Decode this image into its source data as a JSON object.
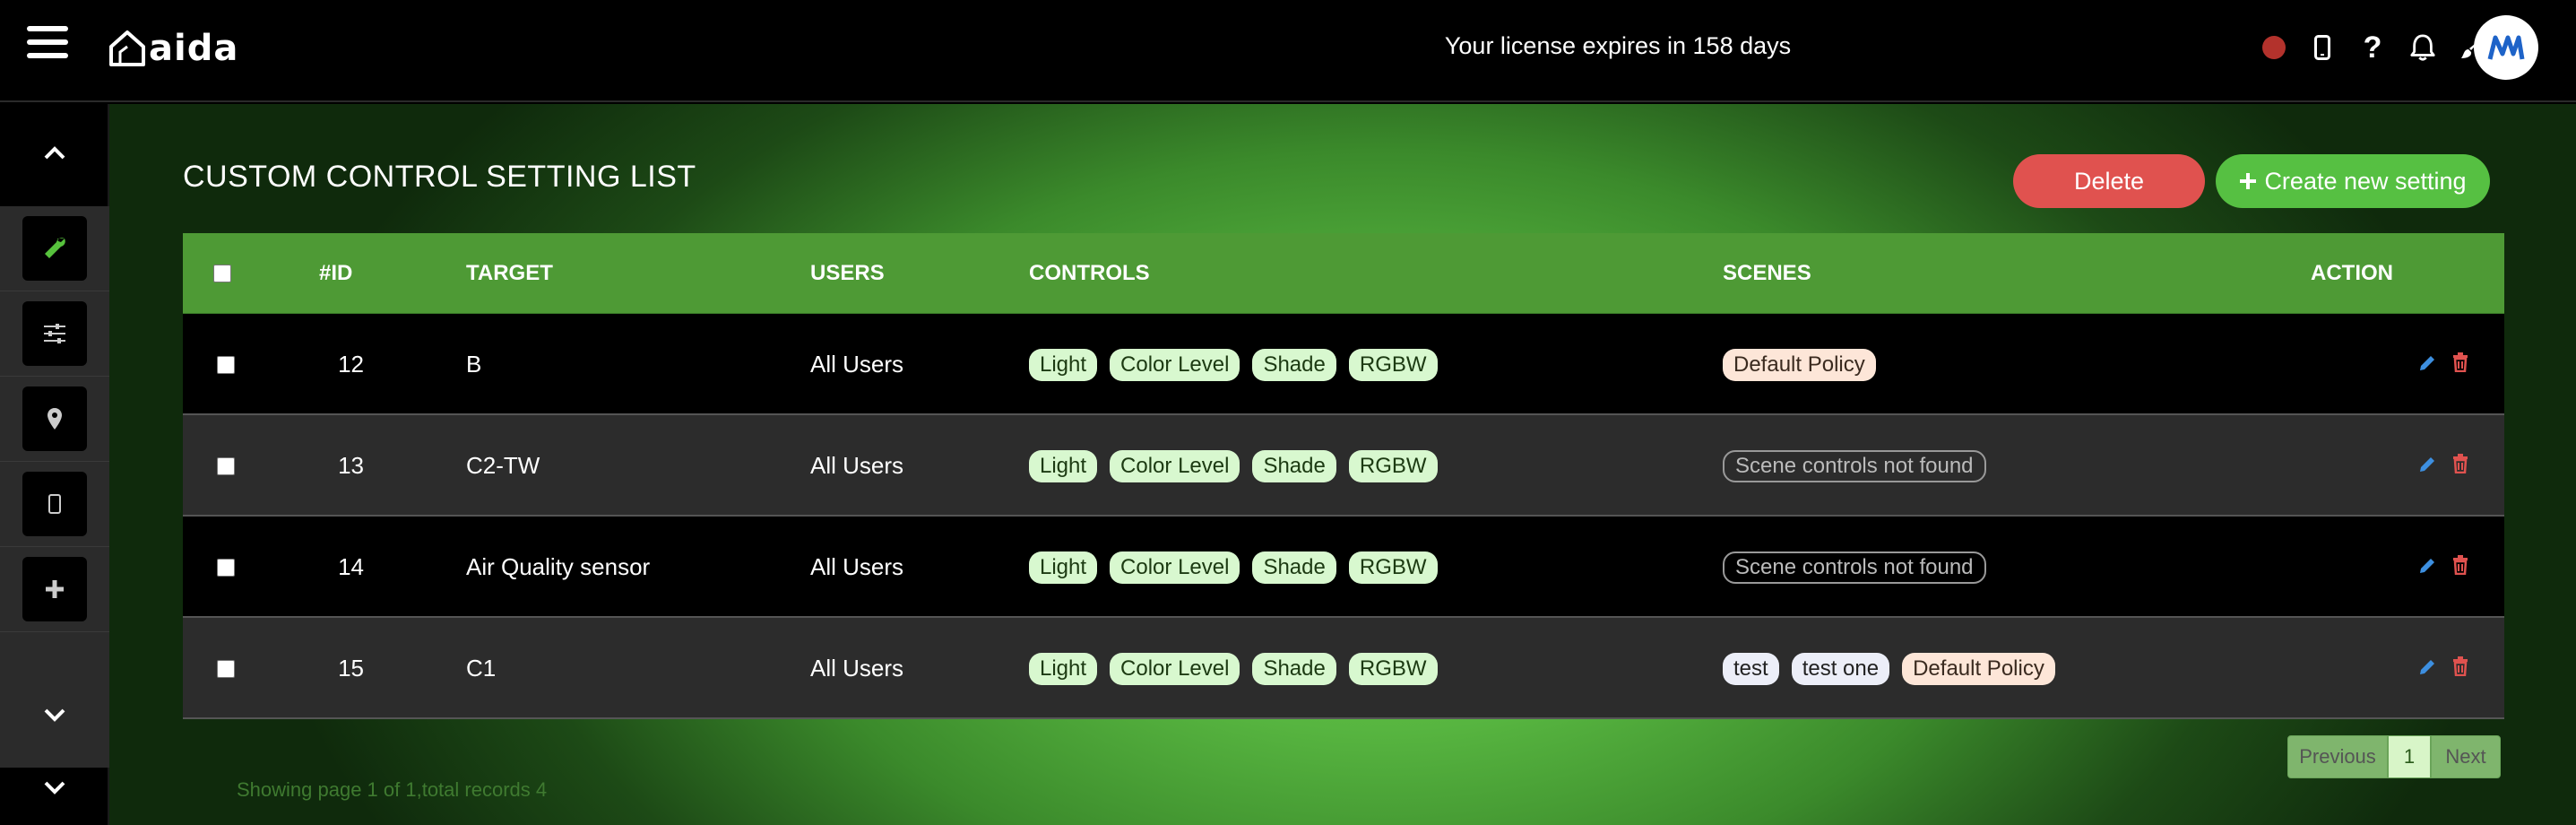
{
  "header": {
    "logo_text": "aida",
    "license_text": "Your license expires in 158 days",
    "icons": [
      "record-dot-icon",
      "mobile-icon",
      "help-icon",
      "bell-icon",
      "brush-icon",
      "user-avatar"
    ]
  },
  "sidebar": {
    "items": [
      {
        "icon": "wrench-icon",
        "active": true
      },
      {
        "icon": "sliders-icon"
      },
      {
        "icon": "location-icon"
      },
      {
        "icon": "mobile-icon"
      },
      {
        "icon": "plus-icon"
      }
    ]
  },
  "page": {
    "title": "CUSTOM CONTROL SETTING LIST",
    "delete_label": "Delete",
    "create_label": "Create new setting"
  },
  "table": {
    "headers": {
      "id": "#ID",
      "target": "TARGET",
      "users": "USERS",
      "controls": "CONTROLS",
      "scenes": "SCENES",
      "action": "ACTION"
    },
    "rows": [
      {
        "id": "12",
        "target": "B",
        "users": "All Users",
        "controls": [
          "Light",
          "Color Level",
          "Shade",
          "RGBW"
        ],
        "scenes": [
          {
            "label": "Default Policy",
            "kind": "policy"
          }
        ]
      },
      {
        "id": "13",
        "target": "C2-TW",
        "users": "All Users",
        "controls": [
          "Light",
          "Color Level",
          "Shade",
          "RGBW"
        ],
        "scenes": [
          {
            "label": "Scene controls not found",
            "kind": "missing"
          }
        ]
      },
      {
        "id": "14",
        "target": "Air Quality sensor",
        "users": "All Users",
        "controls": [
          "Light",
          "Color Level",
          "Shade",
          "RGBW"
        ],
        "scenes": [
          {
            "label": "Scene controls not found",
            "kind": "missing"
          }
        ]
      },
      {
        "id": "15",
        "target": "C1",
        "users": "All Users",
        "controls": [
          "Light",
          "Color Level",
          "Shade",
          "RGBW"
        ],
        "scenes": [
          {
            "label": "test",
            "kind": "scene"
          },
          {
            "label": "test one",
            "kind": "scene"
          },
          {
            "label": "Default Policy",
            "kind": "policy"
          }
        ]
      }
    ]
  },
  "pagination": {
    "previous_label": "Previous",
    "current_page": "1",
    "next_label": "Next",
    "summary": "Showing page 1 of 1,total records 4"
  },
  "colors": {
    "header_green": "#4e9a35",
    "delete_red": "#e0524f",
    "create_green": "#56c042",
    "edit_blue": "#3d8fe0",
    "trash_red": "#e0524f"
  }
}
